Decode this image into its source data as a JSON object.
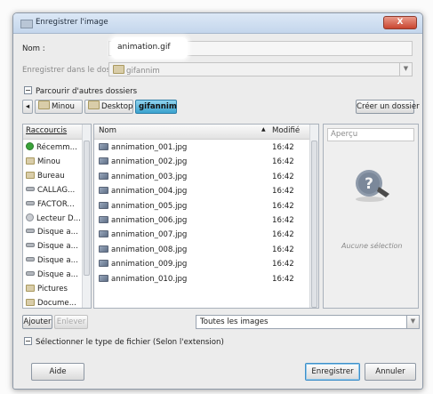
{
  "window": {
    "title": "Enregistrer l'image",
    "close_label": "X"
  },
  "name_field": {
    "label": "Nom :",
    "value": "animation.gif"
  },
  "save_in": {
    "label": "Enregistrer dans le dossier :",
    "value": "gifannim"
  },
  "browse_label": "Parcourir d'autres dossiers",
  "path_bar": {
    "back_arrow": "◂",
    "crumbs": [
      "Minou",
      "Desktop",
      "gifannim"
    ],
    "create_folder": "Créer un dossier"
  },
  "places": {
    "header": "Raccourcis",
    "items": [
      {
        "label": "Récemm...",
        "icon": "recent-icon"
      },
      {
        "label": "Minou",
        "icon": "folder-icon"
      },
      {
        "label": "Bureau",
        "icon": "folder-icon"
      },
      {
        "label": "CALLAG...",
        "icon": "drive-icon"
      },
      {
        "label": "FACTOR...",
        "icon": "drive-icon"
      },
      {
        "label": "Lecteur D...",
        "icon": "cd-icon"
      },
      {
        "label": "Disque a...",
        "icon": "drive-icon"
      },
      {
        "label": "Disque a...",
        "icon": "drive-icon"
      },
      {
        "label": "Disque a...",
        "icon": "drive-icon"
      },
      {
        "label": "Disque a...",
        "icon": "drive-icon"
      },
      {
        "label": "Pictures",
        "icon": "folder-icon"
      },
      {
        "label": "Docume...",
        "icon": "folder-icon"
      }
    ],
    "add_label": "Ajouter",
    "remove_label": "Enlever"
  },
  "files": {
    "col_name": "Nom",
    "col_modified": "Modifié",
    "sort_arrow": "▲",
    "rows": [
      {
        "name": "annimation_001.jpg",
        "time": "16:42"
      },
      {
        "name": "annimation_002.jpg",
        "time": "16:42"
      },
      {
        "name": "annimation_003.jpg",
        "time": "16:42"
      },
      {
        "name": "annimation_004.jpg",
        "time": "16:42"
      },
      {
        "name": "annimation_005.jpg",
        "time": "16:42"
      },
      {
        "name": "annimation_006.jpg",
        "time": "16:42"
      },
      {
        "name": "annimation_007.jpg",
        "time": "16:42"
      },
      {
        "name": "annimation_008.jpg",
        "time": "16:42"
      },
      {
        "name": "annimation_009.jpg",
        "time": "16:42"
      },
      {
        "name": "annimation_010.jpg",
        "time": "16:42"
      }
    ]
  },
  "preview": {
    "header": "Aperçu",
    "no_selection": "Aucune sélection",
    "icon": "question-icon"
  },
  "filter": {
    "value": "Toutes les images"
  },
  "file_type_toggle": "Sélectionner le type de fichier (Selon l'extension)",
  "buttons": {
    "help": "Aide",
    "save": "Enregistrer",
    "cancel": "Annuler"
  },
  "colors": {
    "accent": "#3aa2cf",
    "title_bar": "#c4d6ec",
    "close": "#c9452f"
  }
}
